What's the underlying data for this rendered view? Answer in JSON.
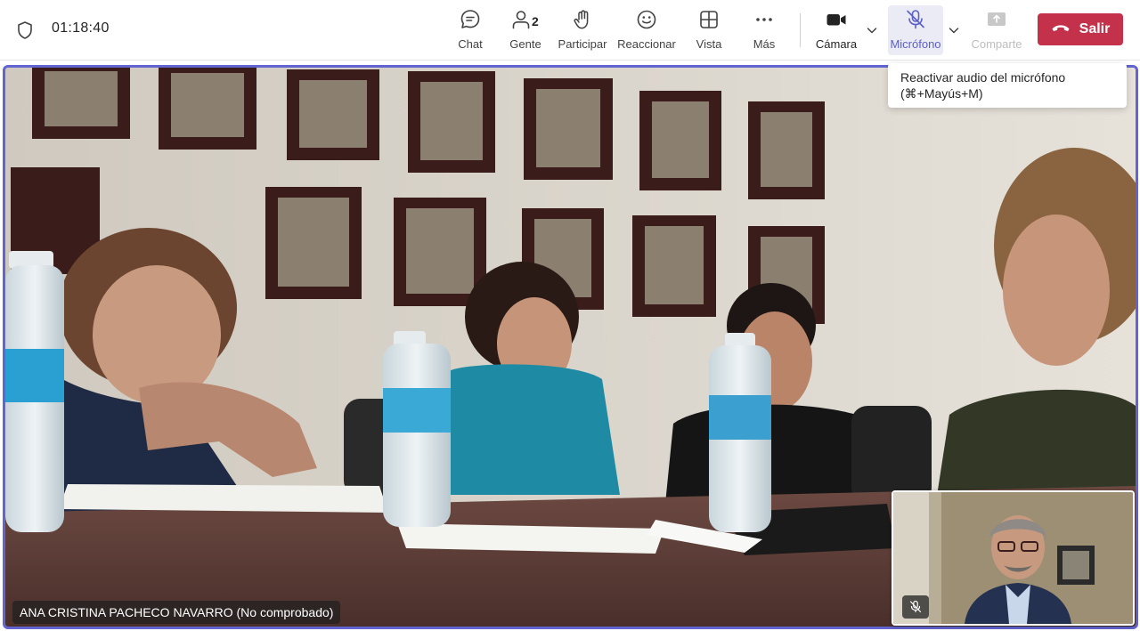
{
  "call": {
    "timer": "01:18:40"
  },
  "toolbar": {
    "chat_label": "Chat",
    "people_label": "Gente",
    "people_count": "2",
    "raise_hand_label": "Participar",
    "react_label": "Reaccionar",
    "view_label": "Vista",
    "more_label": "Más",
    "camera_label": "Cámara",
    "mic_label": "Micrófono",
    "share_label": "Comparte",
    "leave_label": "Salir"
  },
  "tooltip": {
    "line1": "Reactivar audio del micrófono",
    "line2": "(⌘+Mayús+M)"
  },
  "main_video": {
    "participant_name": "ANA CRISTINA PACHECO NAVARRO (No comprobado)"
  },
  "icons": {
    "shield": "shield-icon",
    "chat": "chat-bubble-icon",
    "people": "people-icon",
    "raise_hand": "hand-icon",
    "react": "smiley-icon",
    "view": "grid-icon",
    "more": "ellipsis-icon",
    "camera": "video-camera-icon",
    "mic": "mic-off-icon",
    "share": "share-tray-icon",
    "leave": "phone-hangup-icon"
  },
  "colors": {
    "accent": "#6264d1",
    "mic_active_text": "#5b5fc7",
    "leave_button": "#c4314b",
    "disabled_text": "#bdbdbd"
  }
}
